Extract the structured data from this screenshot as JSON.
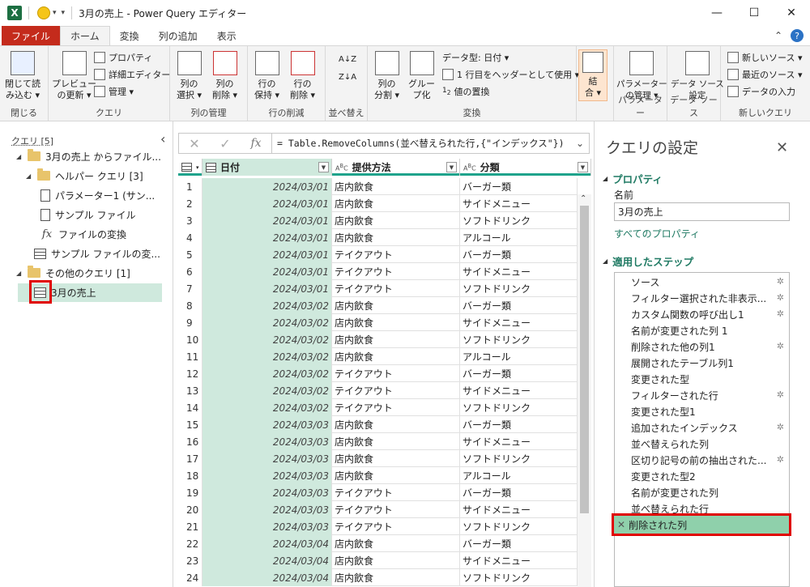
{
  "window": {
    "title": "3月の売上 - Power Query エディター",
    "app_logo": "X",
    "min_glyph": "—",
    "max_glyph": "☐",
    "close_glyph": "✕"
  },
  "ribbon_tabs": [
    "ファイル",
    "ホーム",
    "変換",
    "列の追加",
    "表示"
  ],
  "ribbon_right": {
    "collapse_glyph": "⌃",
    "help_glyph": "?"
  },
  "ribbon": {
    "close": {
      "btn": "閉じて読\nみ込む ▾",
      "group": "閉じる"
    },
    "query": {
      "preview": "プレビュー\nの更新 ▾",
      "properties": "プロパティ",
      "advanced": "詳細エディター",
      "manage": "管理 ▾",
      "group": "クエリ"
    },
    "columns": {
      "select": "列の\n選択 ▾",
      "remove": "列の\n削除 ▾",
      "group": "列の管理"
    },
    "rows": {
      "keep": "行の\n保持 ▾",
      "remove": "行の\n削除 ▾",
      "group": "行の削減"
    },
    "sort": {
      "group": "並べ替え",
      "asc": "A↓Z",
      "desc": "Z↓A"
    },
    "transform": {
      "split": "列の\n分割 ▾",
      "group_by": "グルー\nプ化",
      "datatype": "データ型: 日付 ▾",
      "header": "1 行目をヘッダーとして使用 ▾",
      "replace": "値の置換",
      "group": "変換"
    },
    "combine": {
      "btn": "結\n合 ▾"
    },
    "params": {
      "btn": "パラメーター\nの管理 ▾",
      "group": "パラメーター"
    },
    "datasource": {
      "btn": "データ ソース\n設定",
      "group": "データ ソース"
    },
    "newquery": {
      "new_source": "新しいソース ▾",
      "recent": "最近のソース ▾",
      "enter": "データの入力",
      "group": "新しいクエリ"
    }
  },
  "query_pane": {
    "header": "クエリ [5]",
    "collapse_glyph": "‹",
    "items": [
      {
        "label": "3月の売上 からファイル...",
        "icon": "folder-icon"
      },
      {
        "label": "ヘルパー クエリ [3]",
        "icon": "folder-icon"
      },
      {
        "label": "パラメーター1 (サン...",
        "icon": "parameter-icon"
      },
      {
        "label": "サンプル ファイル",
        "icon": "document-icon"
      },
      {
        "label": "ファイルの変換",
        "icon": "function-icon"
      },
      {
        "label": "サンプル ファイルの変...",
        "icon": "table-icon"
      },
      {
        "label": "その他のクエリ [1]",
        "icon": "folder-icon"
      },
      {
        "label": "3月の売上",
        "icon": "table-icon"
      }
    ]
  },
  "formula": {
    "cancel": "✕",
    "commit": "✓",
    "fx": "fx",
    "text": "= Table.RemoveColumns(並べ替えられた行,{\"インデックス\"})",
    "expand": "⌄"
  },
  "grid": {
    "columns": [
      {
        "name": "日付",
        "type_icon": "calendar-icon"
      },
      {
        "name": "提供方法",
        "type_icon": "abc-icon"
      },
      {
        "name": "分類",
        "type_icon": "abc-icon"
      }
    ],
    "rows": [
      [
        "1",
        "2024/03/01",
        "店内飲食",
        "バーガー類"
      ],
      [
        "2",
        "2024/03/01",
        "店内飲食",
        "サイドメニュー"
      ],
      [
        "3",
        "2024/03/01",
        "店内飲食",
        "ソフトドリンク"
      ],
      [
        "4",
        "2024/03/01",
        "店内飲食",
        "アルコール"
      ],
      [
        "5",
        "2024/03/01",
        "テイクアウト",
        "バーガー類"
      ],
      [
        "6",
        "2024/03/01",
        "テイクアウト",
        "サイドメニュー"
      ],
      [
        "7",
        "2024/03/01",
        "テイクアウト",
        "ソフトドリンク"
      ],
      [
        "8",
        "2024/03/02",
        "店内飲食",
        "バーガー類"
      ],
      [
        "9",
        "2024/03/02",
        "店内飲食",
        "サイドメニュー"
      ],
      [
        "10",
        "2024/03/02",
        "店内飲食",
        "ソフトドリンク"
      ],
      [
        "11",
        "2024/03/02",
        "店内飲食",
        "アルコール"
      ],
      [
        "12",
        "2024/03/02",
        "テイクアウト",
        "バーガー類"
      ],
      [
        "13",
        "2024/03/02",
        "テイクアウト",
        "サイドメニュー"
      ],
      [
        "14",
        "2024/03/02",
        "テイクアウト",
        "ソフトドリンク"
      ],
      [
        "15",
        "2024/03/03",
        "店内飲食",
        "バーガー類"
      ],
      [
        "16",
        "2024/03/03",
        "店内飲食",
        "サイドメニュー"
      ],
      [
        "17",
        "2024/03/03",
        "店内飲食",
        "ソフトドリンク"
      ],
      [
        "18",
        "2024/03/03",
        "店内飲食",
        "アルコール"
      ],
      [
        "19",
        "2024/03/03",
        "テイクアウト",
        "バーガー類"
      ],
      [
        "20",
        "2024/03/03",
        "テイクアウト",
        "サイドメニュー"
      ],
      [
        "21",
        "2024/03/03",
        "テイクアウト",
        "ソフトドリンク"
      ],
      [
        "22",
        "2024/03/04",
        "店内飲食",
        "バーガー類"
      ],
      [
        "23",
        "2024/03/04",
        "店内飲食",
        "サイドメニュー"
      ],
      [
        "24",
        "2024/03/04",
        "店内飲食",
        "ソフトドリンク"
      ]
    ]
  },
  "settings": {
    "title": "クエリの設定",
    "close_glyph": "✕",
    "properties_header": "プロパティ",
    "name_label": "名前",
    "name_value": "3月の売上",
    "all_props": "すべてのプロパティ",
    "steps_header": "適用したステップ",
    "steps": [
      {
        "label": "ソース",
        "gear": true
      },
      {
        "label": "フィルター選択された非表示...",
        "gear": true
      },
      {
        "label": "カスタム関数の呼び出し1",
        "gear": true
      },
      {
        "label": "名前が変更された列 1",
        "gear": false
      },
      {
        "label": "削除された他の列1",
        "gear": true
      },
      {
        "label": "展開されたテーブル列1",
        "gear": false
      },
      {
        "label": "変更された型",
        "gear": false
      },
      {
        "label": "フィルターされた行",
        "gear": true
      },
      {
        "label": "変更された型1",
        "gear": false
      },
      {
        "label": "追加されたインデックス",
        "gear": true
      },
      {
        "label": "並べ替えられた列",
        "gear": false
      },
      {
        "label": "区切り記号の前の抽出された...",
        "gear": true
      },
      {
        "label": "変更された型2",
        "gear": false
      },
      {
        "label": "名前が変更された列",
        "gear": false
      },
      {
        "label": "並べ替えられた行",
        "gear": false
      },
      {
        "label": "削除された列",
        "gear": false,
        "active": true
      }
    ]
  },
  "colors": {
    "accent": "#1fa38c",
    "file_tab": "#c42b1c",
    "highlight": "#e00000",
    "selected_col": "#cfe9dd"
  }
}
